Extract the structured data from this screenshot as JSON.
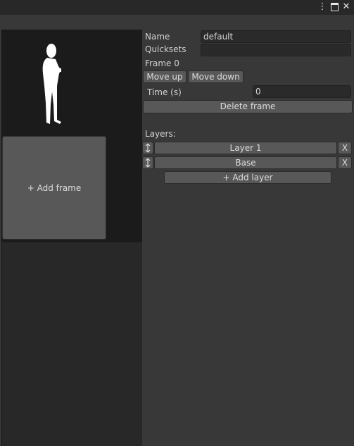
{
  "window": {
    "menu_icon": "more-vertical-icon",
    "maximize_icon": "maximize-icon",
    "close_icon": "close-icon",
    "close_glyph": "✕"
  },
  "frames": {
    "add_frame_label": "+ Add frame",
    "thumbnail_icon": "person-silhouette-icon"
  },
  "properties": {
    "name_label": "Name",
    "name_value": "default",
    "quicksets_label": "Quicksets",
    "quicksets_value": "",
    "frame_label": "Frame 0",
    "move_up_label": "Move up",
    "move_down_label": "Move down",
    "time_label": "Time (s)",
    "time_value": "0",
    "delete_frame_label": "Delete frame"
  },
  "layers": {
    "heading": "Layers:",
    "items": [
      {
        "name": "Layer 1",
        "remove_label": "X"
      },
      {
        "name": "Base",
        "remove_label": "X"
      }
    ],
    "add_layer_label": "+ Add layer",
    "drag_icon": "drag-vertical-icon"
  },
  "colors": {
    "panel_bg": "#383838",
    "frame_bg": "#1b1b1b",
    "button_bg": "#585858",
    "field_bg": "#2a2a2a"
  }
}
